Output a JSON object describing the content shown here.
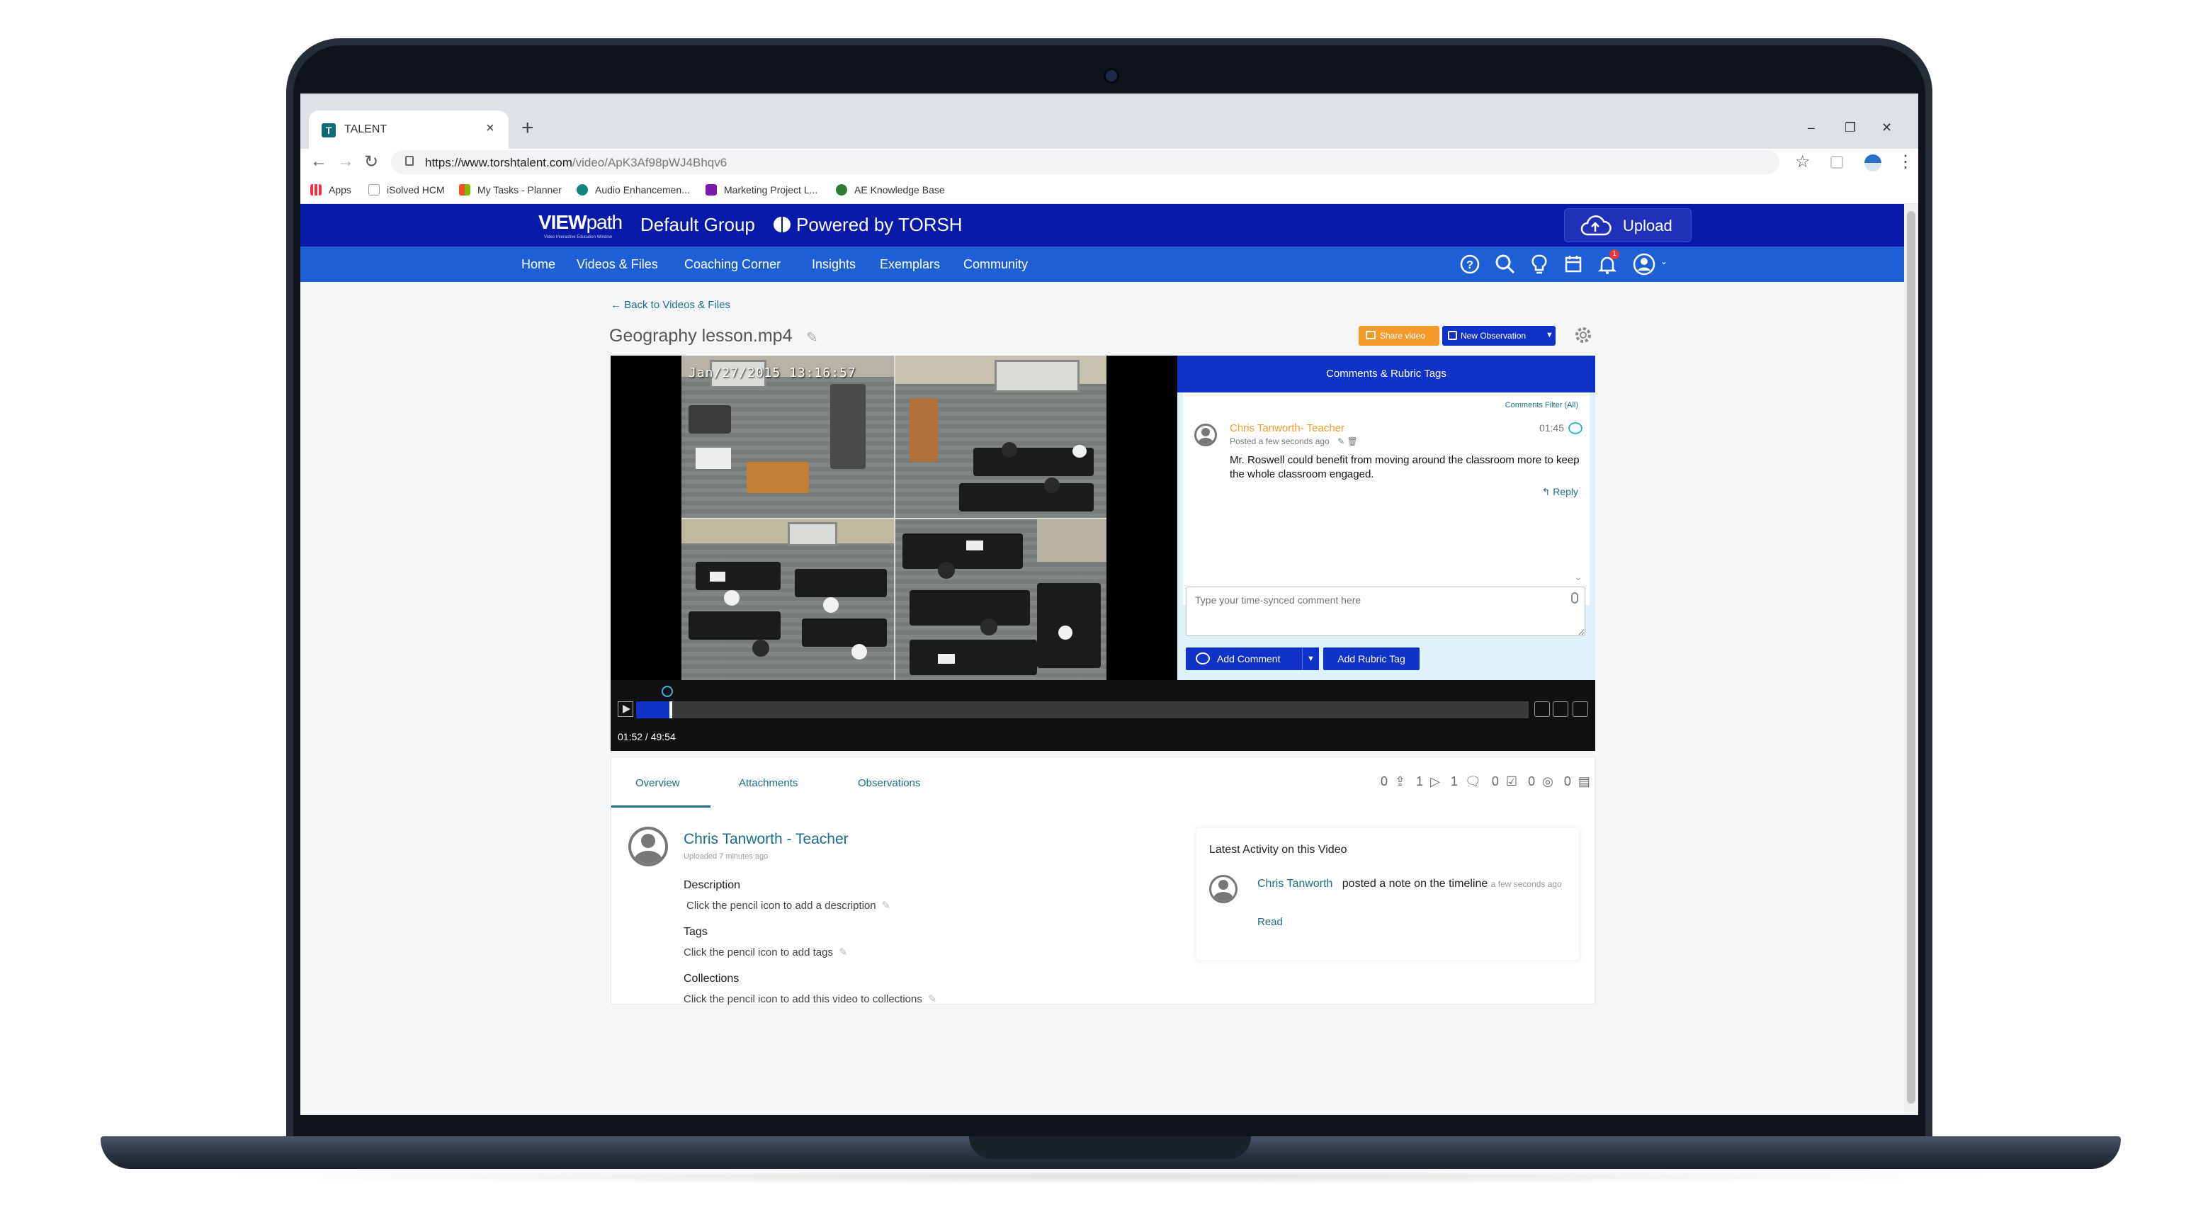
{
  "browser": {
    "tab_title": "TALENT",
    "url_host": "https://www.torshtalent.com",
    "url_path": "/video/ApK3Af98pWJ4Bhqv6",
    "bookmarks": [
      "Apps",
      "iSolved HCM",
      "My Tasks - Planner",
      "Audio Enhancemen...",
      "Marketing Project L...",
      "AE Knowledge Base"
    ]
  },
  "header": {
    "logo_bold": "VIEW",
    "logo_light": "path",
    "logo_tagline": "Video Interactive Education Window",
    "group": "Default Group",
    "powered": "Powered by TORSH",
    "upload_label": "Upload"
  },
  "nav": {
    "items": [
      "Home",
      "Videos & Files",
      "Coaching Corner",
      "Insights",
      "Exemplars",
      "Community"
    ],
    "notification_count": "1"
  },
  "page": {
    "back_link": "Back to Videos & Files",
    "video_title": "Geography lesson.mp4",
    "share_label": "Share video",
    "new_observation_label": "New Observation"
  },
  "player": {
    "timestamp": "Jan/27/2015  13:16:57",
    "timecode": "01:52 / 49:54",
    "progress": 0.037,
    "comment_marker_position": 0.035
  },
  "comments": {
    "header": "Comments & Rubric Tags",
    "filter": "Comments Filter (All)",
    "items": [
      {
        "author": "Chris Tanworth- Teacher",
        "time": "01:45",
        "posted": "Posted a few seconds ago",
        "text": "Mr. Roswell could benefit from moving around the classroom more to keep the whole classroom engaged.",
        "reply_label": "Reply"
      }
    ],
    "input_placeholder": "Type your time-synced comment here",
    "add_comment_label": "Add Comment",
    "add_rubric_label": "Add Rubric Tag"
  },
  "details": {
    "tabs": [
      "Overview",
      "Attachments",
      "Observations"
    ],
    "counters": [
      "0",
      "1",
      "1",
      "0",
      "0",
      "0"
    ],
    "owner": "Chris Tanworth - Teacher",
    "uploaded": "Uploaded 7 minutes ago",
    "fields": [
      {
        "label": "Description",
        "hint": "Click the pencil icon to add a description"
      },
      {
        "label": "Tags",
        "hint": "Click the pencil icon to add tags"
      },
      {
        "label": "Collections",
        "hint": "Click the pencil icon to add this video to collections"
      }
    ],
    "activity": {
      "title": "Latest Activity on this Video",
      "name": "Chris Tanworth",
      "action": "posted a note on the timeline",
      "ago": "a few seconds ago",
      "read_label": "Read"
    }
  },
  "colors": {
    "brand_dark": "#0a1aa8",
    "brand_nav": "#1f5fd6",
    "accent_orange": "#f39a2a",
    "link_teal": "#1c6c8c"
  }
}
